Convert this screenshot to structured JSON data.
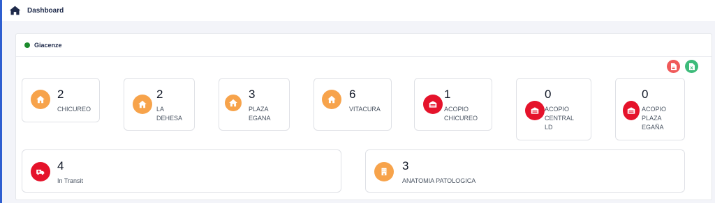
{
  "header": {
    "title": "Dashboard",
    "icon": "home-icon"
  },
  "panel": {
    "title": "Giacenze",
    "status_color": "#1b8a2c",
    "actions": [
      {
        "name": "export-pdf-button",
        "icon": "pdf-file-icon",
        "color": "#f05a5a"
      },
      {
        "name": "export-excel-button",
        "icon": "excel-file-icon",
        "color": "#3dbb7a"
      }
    ]
  },
  "cards": [
    {
      "count": "2",
      "label": "CHICUREO",
      "icon": "home-icon",
      "color": "#f7a34b"
    },
    {
      "count": "2",
      "label": "LA DEHESA",
      "icon": "home-icon",
      "color": "#f7a34b"
    },
    {
      "count": "3",
      "label": "PLAZA EGANA",
      "icon": "home-icon",
      "color": "#f7a34b"
    },
    {
      "count": "6",
      "label": "VITACURA",
      "icon": "home-icon",
      "color": "#f7a34b"
    },
    {
      "count": "1",
      "label": "ACOPIO CHICUREO",
      "icon": "warehouse-icon",
      "color": "#e5132b"
    },
    {
      "count": "0",
      "label": "ACOPIO CENTRAL LD",
      "icon": "warehouse-icon",
      "color": "#e5132b"
    },
    {
      "count": "0",
      "label": "ACOPIO PLAZA EGAÑA",
      "icon": "warehouse-icon",
      "color": "#e5132b"
    },
    {
      "count": "4",
      "label": "In Transit",
      "icon": "ambulance-icon",
      "color": "#e5132b"
    },
    {
      "count": "3",
      "label": "ANATOMIA PATOLOGICA",
      "icon": "building-icon",
      "color": "#f7a34b"
    }
  ]
}
